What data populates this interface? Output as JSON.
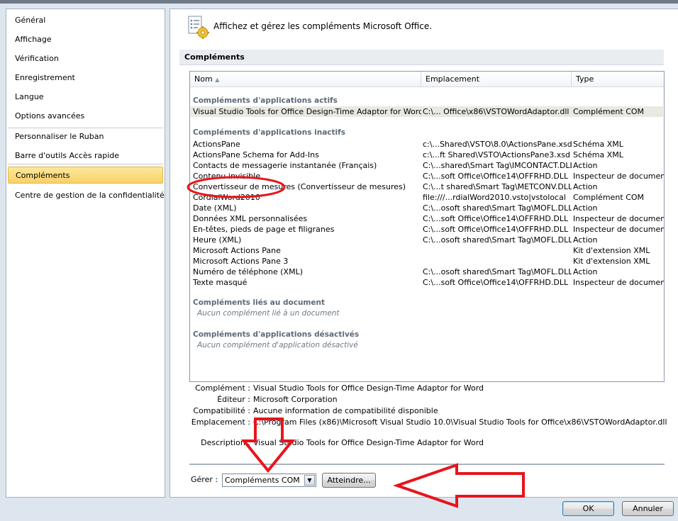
{
  "sidebar": {
    "items": [
      {
        "label": "Général"
      },
      {
        "label": "Affichage"
      },
      {
        "label": "Vérification"
      },
      {
        "label": "Enregistrement"
      },
      {
        "label": "Langue"
      },
      {
        "label": "Options avancées"
      },
      {
        "label": "Personnaliser le Ruban"
      },
      {
        "label": "Barre d'outils Accès rapide"
      },
      {
        "label": "Compléments"
      },
      {
        "label": "Centre de gestion de la confidentialité"
      }
    ],
    "selected": "Compléments"
  },
  "header": {
    "title": "Affichez et gérez les compléments Microsoft Office.",
    "icon": "addins-gear-icon"
  },
  "section": {
    "title": "Compléments"
  },
  "table": {
    "columns": [
      "Nom",
      "Emplacement",
      "Type"
    ],
    "groups": [
      {
        "title": "Compléments d'applications actifs",
        "rows": [
          {
            "name": "Visual Studio Tools for Office Design-Time Adaptor for Word",
            "location": "C:\\... Office\\x86\\VSTOWordAdaptor.dll",
            "type": "Complément COM",
            "selected": true
          }
        ]
      },
      {
        "title": "Compléments d'applications inactifs",
        "rows": [
          {
            "name": "ActionsPane",
            "location": "c:\\...Shared\\VSTO\\8.0\\ActionsPane.xsd",
            "type": "Schéma XML"
          },
          {
            "name": "ActionsPane Schema for Add-Ins",
            "location": "c:\\...ft Shared\\VSTO\\ActionsPane3.xsd",
            "type": "Schéma XML"
          },
          {
            "name": "Contacts de messagerie instantanée (Français)",
            "location": "C:\\...shared\\Smart Tag\\IMCONTACT.DLL",
            "type": "Action"
          },
          {
            "name": "Contenu invisible",
            "location": "C:\\...soft Office\\Office14\\OFFRHD.DLL",
            "type": "Inspecteur de document"
          },
          {
            "name": "Convertisseur de mesures (Convertisseur de mesures)",
            "location": "C:\\...t shared\\Smart Tag\\METCONV.DLL",
            "type": "Action"
          },
          {
            "name": "CordialWord2010",
            "location": "file:///...rdialWord2010.vsto|vstolocal",
            "type": "Complément COM"
          },
          {
            "name": "Date (XML)",
            "location": "C:\\...osoft shared\\Smart Tag\\MOFL.DLL",
            "type": "Action"
          },
          {
            "name": "Données XML personnalisées",
            "location": "C:\\...soft Office\\Office14\\OFFRHD.DLL",
            "type": "Inspecteur de document"
          },
          {
            "name": "En-têtes, pieds de page et filigranes",
            "location": "C:\\...soft Office\\Office14\\OFFRHD.DLL",
            "type": "Inspecteur de document"
          },
          {
            "name": "Heure (XML)",
            "location": "C:\\...osoft shared\\Smart Tag\\MOFL.DLL",
            "type": "Action"
          },
          {
            "name": "Microsoft Actions Pane",
            "location": "",
            "type": "Kit d'extension XML"
          },
          {
            "name": "Microsoft Actions Pane 3",
            "location": "",
            "type": "Kit d'extension XML"
          },
          {
            "name": "Numéro de téléphone (XML)",
            "location": "C:\\...osoft shared\\Smart Tag\\MOFL.DLL",
            "type": "Action"
          },
          {
            "name": "Texte masqué",
            "location": "C:\\...soft Office\\Office14\\OFFRHD.DLL",
            "type": "Inspecteur de document"
          }
        ]
      },
      {
        "title": "Compléments liés au document",
        "empty_note": "Aucun complément lié à un document"
      },
      {
        "title": "Compléments d'applications désactivés",
        "empty_note": "Aucun complément d'application désactivé"
      }
    ]
  },
  "details": [
    {
      "label": "Complément :",
      "value": "Visual Studio Tools for Office Design-Time Adaptor for Word"
    },
    {
      "label": "Éditeur :",
      "value": "Microsoft Corporation"
    },
    {
      "label": "Compatibilité :",
      "value": "Aucune information de compatibilité disponible"
    },
    {
      "label": "Emplacement :",
      "value": "C:\\Program Files (x86)\\Microsoft Visual Studio 10.0\\Visual Studio Tools for Office\\x86\\VSTOWordAdaptor.dll"
    },
    {
      "label": "Description :",
      "value": "Visual Studio Tools for Office Design-Time Adaptor for Word"
    }
  ],
  "manage": {
    "label": "Gérer :",
    "selected": "Compléments COM",
    "go_button": "Atteindre..."
  },
  "buttons": {
    "ok": "OK",
    "cancel": "Annuler"
  },
  "annotations": {
    "color": "#e8141b"
  }
}
